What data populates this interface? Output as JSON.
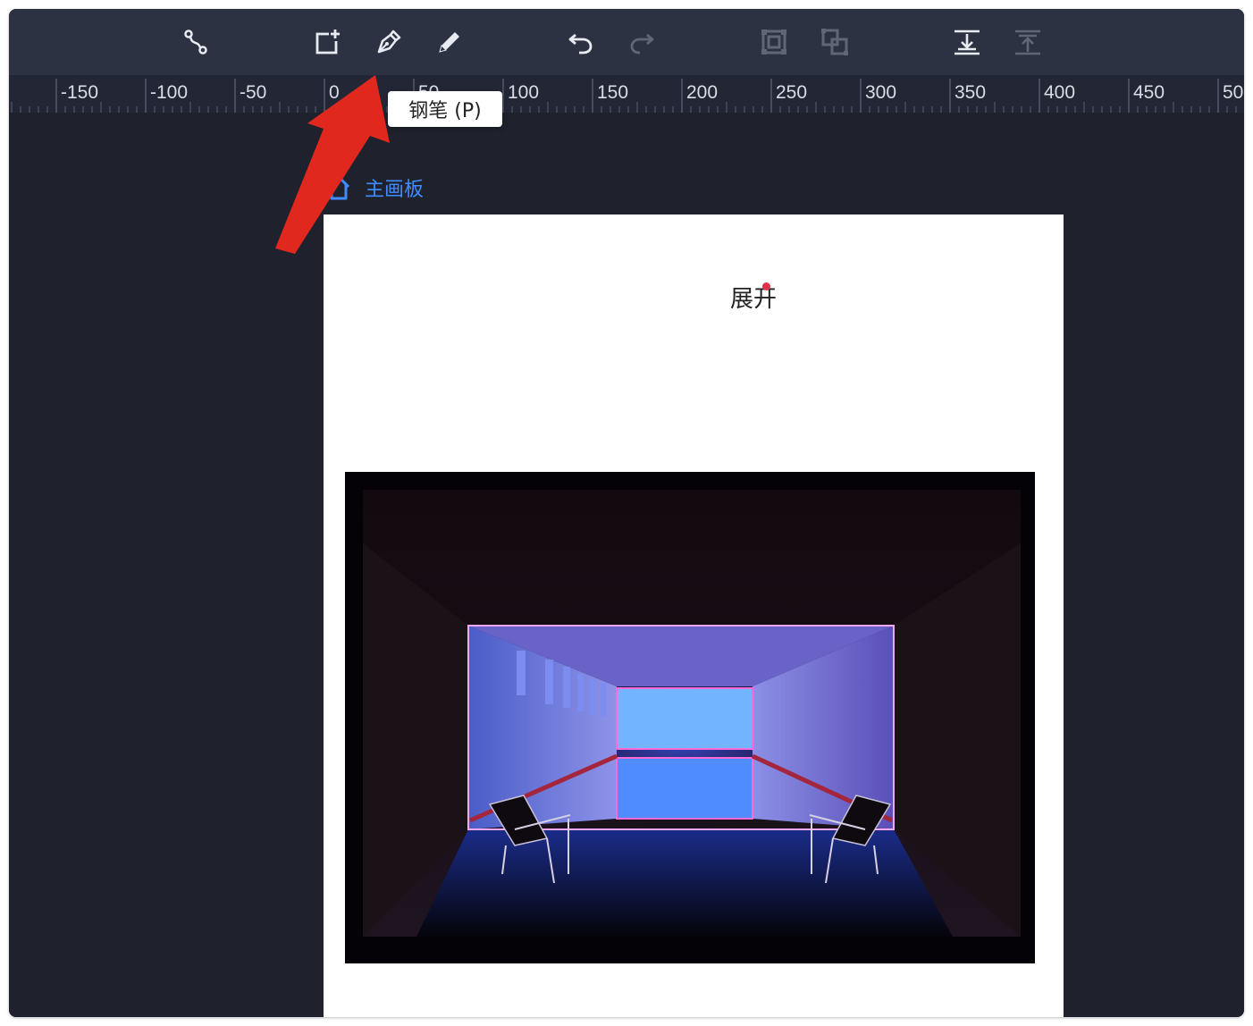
{
  "toolbar": {
    "buttons": [
      {
        "name": "path-tool",
        "icon": "bezier-path-icon",
        "enabled": true
      },
      {
        "name": "add-artboard",
        "icon": "add-frame-icon",
        "enabled": true
      },
      {
        "name": "pen-tool",
        "icon": "pen-nib-icon",
        "enabled": true
      },
      {
        "name": "pencil-tool",
        "icon": "pencil-icon",
        "enabled": true
      },
      {
        "name": "undo",
        "icon": "undo-icon",
        "enabled": true
      },
      {
        "name": "redo",
        "icon": "redo-icon",
        "enabled": false
      },
      {
        "name": "group",
        "icon": "group-icon",
        "enabled": false
      },
      {
        "name": "ungroup",
        "icon": "ungroup-icon",
        "enabled": false
      },
      {
        "name": "bring-down",
        "icon": "align-down-icon",
        "enabled": true
      },
      {
        "name": "bring-up",
        "icon": "align-up-icon",
        "enabled": false
      }
    ],
    "tooltip": "钢笔 (P)"
  },
  "ruler": {
    "labels": [
      "0",
      "-150",
      "-100",
      "-50",
      "0",
      "50",
      "100",
      "150",
      "200",
      "250",
      "300",
      "350",
      "400",
      "450",
      "50"
    ]
  },
  "artboard": {
    "label": "主画板",
    "text": "展开"
  },
  "colors": {
    "toolbar_bg": "#2c3241",
    "canvas_bg": "#1f222d",
    "accent": "#3f8cff",
    "arrow": "#e0281e"
  }
}
